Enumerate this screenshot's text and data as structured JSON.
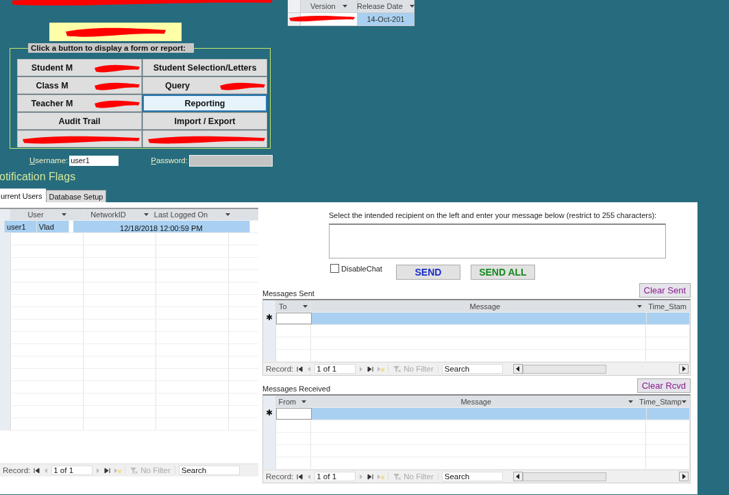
{
  "version_table": {
    "columns": [
      "Version",
      "Release Date"
    ],
    "release_date": "14-Oct-201"
  },
  "menu": {
    "legend": "Click a button to display a form or report:",
    "buttons": [
      {
        "label": "Student M",
        "selected": false,
        "redacted": true
      },
      {
        "label": "Student Selection/Letters",
        "selected": false,
        "redacted": false
      },
      {
        "label": "Class M",
        "selected": false,
        "redacted": true
      },
      {
        "label": "Query",
        "selected": false,
        "redacted": true
      },
      {
        "label": "Teacher M",
        "selected": false,
        "redacted": true
      },
      {
        "label": "Reporting",
        "selected": true,
        "redacted": false
      },
      {
        "label": "Audit Trail",
        "selected": false,
        "redacted": false
      },
      {
        "label": "Import / Export",
        "selected": false,
        "redacted": false
      },
      {
        "selected": false,
        "redacted": true
      },
      {
        "selected": false,
        "redacted": true
      }
    ]
  },
  "login": {
    "username_label": "Username:",
    "username": "user1",
    "password_label": "Password:"
  },
  "section_title": "otification Flags",
  "tabs": [
    {
      "label": "urrent Users",
      "selected": true
    },
    {
      "label": "Database Setup",
      "selected": false
    }
  ],
  "users_grid": {
    "columns": [
      "User",
      "NetworkID",
      "Last Logged On"
    ],
    "rows": [
      {
        "cells": [
          "user1",
          "Vlad",
          "12/18/2018 12:00:59 PM"
        ],
        "selected": true
      }
    ],
    "nav": {
      "label": "Record:",
      "position": "1 of 1",
      "filter": "No Filter",
      "search": "Search"
    }
  },
  "chat": {
    "instructions": "Select the intended recipient on the left and enter your message below (restrict to 255 characters):",
    "disable_chat": {
      "label": "DisableChat",
      "checked": false
    },
    "send": "SEND",
    "send_all": "SEND ALL"
  },
  "messages_sent": {
    "title": "Messages Sent",
    "clear": "Clear Sent",
    "columns": [
      "To",
      "Message",
      "Time_Stam"
    ],
    "new_row_marker": "✱",
    "nav": {
      "label": "Record:",
      "position": "1 of 1",
      "filter": "No Filter",
      "search": "Search"
    }
  },
  "messages_received": {
    "title": "Messages Received",
    "clear": "Clear Rcvd",
    "columns": [
      "From",
      "Message",
      "Time_Stamp"
    ],
    "new_row_marker": "✱",
    "nav": {
      "label": "Record:",
      "position": "1 of 1",
      "filter": "No Filter",
      "search": "Search"
    }
  }
}
